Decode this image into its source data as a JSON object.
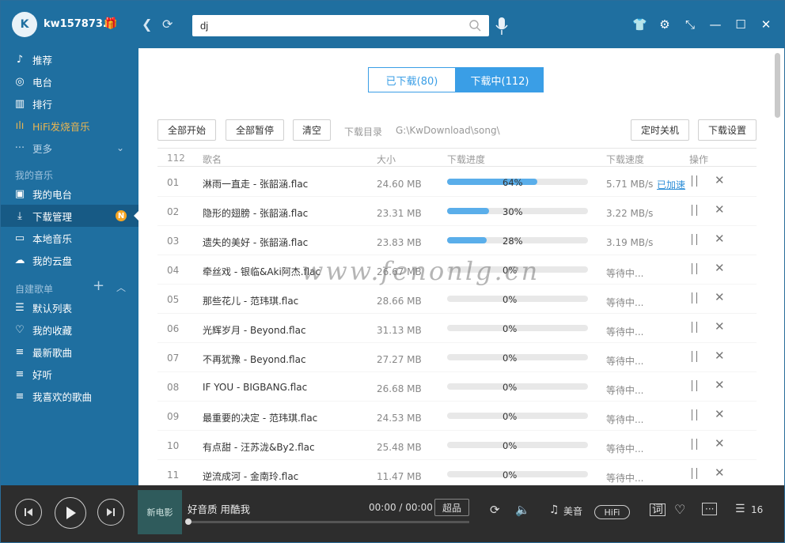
{
  "header": {
    "username": "kw157873...",
    "search_value": "dj",
    "search_placeholder": ""
  },
  "sidebar": {
    "items_top": [
      {
        "label": "推荐",
        "icon": "music-note-icon"
      },
      {
        "label": "电台",
        "icon": "radio-icon"
      },
      {
        "label": "排行",
        "icon": "chart-icon"
      },
      {
        "label": "HiFi发烧音乐",
        "icon": "waveform-icon"
      },
      {
        "label": "更多",
        "icon": "more-dots-icon"
      }
    ],
    "my_music_title": "我的音乐",
    "my_music": [
      {
        "label": "我的电台",
        "icon": "radio-box-icon"
      },
      {
        "label": "下载管理",
        "icon": "download-icon",
        "badge": "N"
      },
      {
        "label": "本地音乐",
        "icon": "monitor-icon"
      },
      {
        "label": "我的云盘",
        "icon": "cloud-icon"
      }
    ],
    "playlist_title": "自建歌单",
    "playlists": [
      {
        "label": "默认列表",
        "icon": "list-icon"
      },
      {
        "label": "我的收藏",
        "icon": "heart-icon"
      },
      {
        "label": "最新歌曲",
        "icon": "playlist-icon"
      },
      {
        "label": "好听",
        "icon": "playlist-icon"
      },
      {
        "label": "我喜欢的歌曲",
        "icon": "playlist-icon"
      }
    ]
  },
  "tabs": [
    {
      "label": "已下载(80)",
      "active": false
    },
    {
      "label": "下载中(112)",
      "active": true
    }
  ],
  "toolbar": {
    "start_all": "全部开始",
    "pause_all": "全部暂停",
    "clear": "清空",
    "dir_label": "下载目录",
    "dir_path": "G:\\KwDownload\\song\\",
    "shutdown": "定时关机",
    "settings": "下载设置"
  },
  "table": {
    "count": "112",
    "headers": {
      "name": "歌名",
      "size": "大小",
      "progress": "下载进度",
      "speed": "下载速度",
      "action": "操作"
    },
    "boost_label": "已加速",
    "rows": [
      {
        "no": "01",
        "name": "淋雨一直走 - 张韶涵.flac",
        "size": "24.60 MB",
        "progress": 64,
        "pct": "64%",
        "speed": "5.71 MB/s",
        "boost": true
      },
      {
        "no": "02",
        "name": "隐形的翅膀 - 张韶涵.flac",
        "size": "23.31 MB",
        "progress": 30,
        "pct": "30%",
        "speed": "3.22 MB/s",
        "boost": false
      },
      {
        "no": "03",
        "name": "遗失的美好 - 张韶涵.flac",
        "size": "23.83 MB",
        "progress": 28,
        "pct": "28%",
        "speed": "3.19 MB/s",
        "boost": false
      },
      {
        "no": "04",
        "name": "牵丝戏 - 银临&Aki阿杰.flac",
        "size": "26.67 MB",
        "progress": 0,
        "pct": "0%",
        "speed": "等待中...",
        "boost": false
      },
      {
        "no": "05",
        "name": "那些花儿 - 范玮琪.flac",
        "size": "28.66 MB",
        "progress": 0,
        "pct": "0%",
        "speed": "等待中...",
        "boost": false
      },
      {
        "no": "06",
        "name": "光辉岁月 - Beyond.flac",
        "size": "31.13 MB",
        "progress": 0,
        "pct": "0%",
        "speed": "等待中...",
        "boost": false
      },
      {
        "no": "07",
        "name": "不再犹豫 - Beyond.flac",
        "size": "27.27 MB",
        "progress": 0,
        "pct": "0%",
        "speed": "等待中...",
        "boost": false
      },
      {
        "no": "08",
        "name": "IF YOU - BIGBANG.flac",
        "size": "26.68 MB",
        "progress": 0,
        "pct": "0%",
        "speed": "等待中...",
        "boost": false
      },
      {
        "no": "09",
        "name": "最重要的决定 - 范玮琪.flac",
        "size": "24.53 MB",
        "progress": 0,
        "pct": "0%",
        "speed": "等待中...",
        "boost": false
      },
      {
        "no": "10",
        "name": "有点甜 - 汪苏泷&By2.flac",
        "size": "25.48 MB",
        "progress": 0,
        "pct": "0%",
        "speed": "等待中...",
        "boost": false
      },
      {
        "no": "11",
        "name": "逆流成河 - 金南玲.flac",
        "size": "11.47 MB",
        "progress": 0,
        "pct": "0%",
        "speed": "等待中...",
        "boost": false
      }
    ]
  },
  "watermark": "www.fenonlg.cn",
  "player": {
    "cover_text": "新电影",
    "title": "好音质 用酷我",
    "time": "00:00 / 00:00",
    "quality": "超品",
    "sound_effect": "美音",
    "hifi": "HiFi",
    "playlist_count": "16",
    "progress": 0
  },
  "colors": {
    "accent": "#3a9ee6",
    "sidebar": "#1f6fa0",
    "player": "#2d2d2d"
  }
}
